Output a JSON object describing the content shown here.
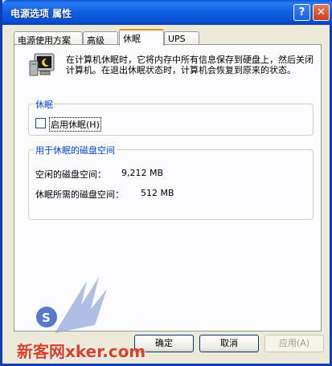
{
  "window": {
    "title": "电源选项 属性",
    "help_glyph": "?",
    "close_glyph": "✕"
  },
  "tabs": [
    {
      "label": "电源使用方案"
    },
    {
      "label": "高级"
    },
    {
      "label": "休眠",
      "active": true
    },
    {
      "label": "UPS"
    }
  ],
  "hibernate": {
    "description": "在计算机休眠时，它将内存中所有信息保存到硬盘上，然后关闭计算机。在退出休眠状态时，计算机会恢复到原来的状态。",
    "group_title": "休眠",
    "checkbox_label": "启用休眠(H)",
    "checkbox_checked": false
  },
  "disk_space": {
    "group_title": "用于休眠的磁盘空间",
    "free_label": "空闲的磁盘空间：",
    "free_value": "9,212 MB",
    "required_label": "休眠所需的磁盘空间：",
    "required_value": "512 MB"
  },
  "buttons": {
    "ok": "确定",
    "cancel": "取消",
    "apply": "应用(A)"
  },
  "watermark": {
    "text": "新客网xker.com"
  },
  "colors": {
    "titlebar": "#0a55d8",
    "group_title": "#0046d5",
    "tab_active_accent": "#e68b2c"
  }
}
